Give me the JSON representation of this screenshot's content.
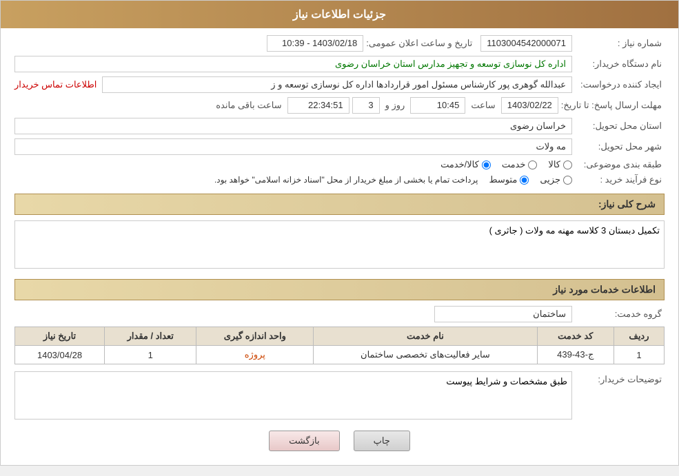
{
  "header": {
    "title": "جزئیات اطلاعات نیاز"
  },
  "fields": {
    "shomara_niaz_label": "شماره نیاز :",
    "shomara_niaz_value": "1103004542000071",
    "dastgah_label": "نام دستگاه خریدار:",
    "dastgah_value": "اداره کل نوسازی  توسعه و تجهیز مدارس استان خراسان رضوی",
    "ejad_label": "ایجاد کننده درخواست:",
    "ejad_value": "عبدالله گوهری پور کارشناس مسئول امور قراردادها  اداره کل نوسازی  توسعه و ز",
    "ejad_link": "اطلاعات تماس خریدار",
    "mohlat_label": "مهلت ارسال پاسخ: تا تاریخ:",
    "mohlat_date": "1403/02/22",
    "mohlat_saat_label": "ساعت",
    "mohlat_saat_value": "10:45",
    "mohlat_rooz_label": "روز و",
    "mohlat_rooz_value": "3",
    "mohlat_mande_value": "22:34:51",
    "mohlat_mande_label": "ساعت باقی مانده",
    "ostan_label": "استان محل تحویل:",
    "ostan_value": "خراسان رضوی",
    "shahr_label": "شهر محل تحویل:",
    "shahr_value": "مه ولات",
    "tabaqe_label": "طبقه بندی موضوعی:",
    "tabaqe_kala": "کالا",
    "tabaqe_khedmat": "خدمت",
    "tabaqe_kala_khedmat": "کالا/خدمت",
    "tabaqe_selected": "kala_khedmat",
    "tarikh_label": "تاریخ و ساعت اعلان عمومی:",
    "tarikh_value": "1403/02/18 - 10:39",
    "nooe_label": "نوع فرآیند خرید :",
    "nooe_jezee": "جزیی",
    "nooe_mottavasset": "متوسط",
    "nooe_text": "پرداخت تمام یا بخشی از مبلغ خریدار از محل \"اسناد خزانه اسلامی\" خواهد بود.",
    "sharh_label": "شرح کلی نیاز:",
    "sharh_value": "تکمیل دبستان 3 کلاسه مهنه مه ولات ( جاثری )",
    "khadamat_title": "اطلاعات خدمات مورد نیاز",
    "grohe_label": "گروه خدمت:",
    "grohe_value": "ساختمان",
    "table": {
      "headers": [
        "ردیف",
        "کد خدمت",
        "نام خدمت",
        "واحد اندازه گیری",
        "تعداد / مقدار",
        "تاریخ نیاز"
      ],
      "rows": [
        {
          "radif": "1",
          "kod": "ج-43-439",
          "naam": "سایر فعالیت‌های تخصصی ساختمان",
          "vahed": "پروژه",
          "tedad": "1",
          "tarikh": "1403/04/28"
        }
      ]
    },
    "toseef_label": "توضیحات خریدار:",
    "toseef_value": "طبق مشخصات و شرایط پیوست"
  },
  "buttons": {
    "print": "چاپ",
    "back": "بازگشت"
  }
}
